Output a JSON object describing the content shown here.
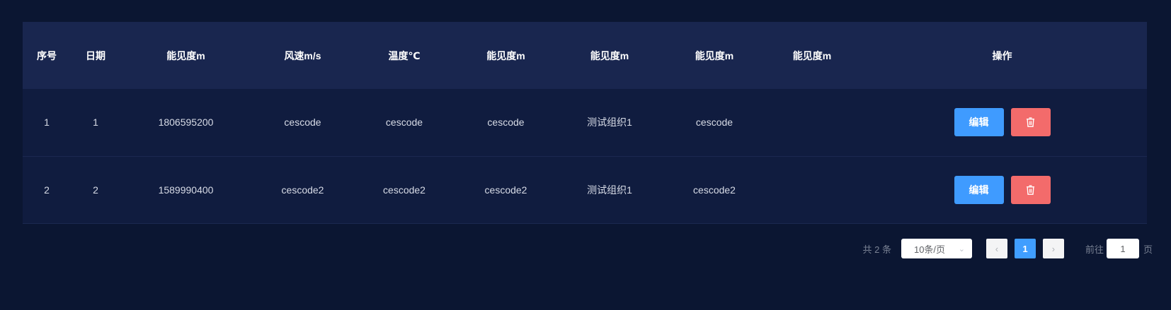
{
  "table": {
    "columns": [
      "序号",
      "日期",
      "能见度m",
      "风速m/s",
      "温度℃",
      "能见度m",
      "能见度m",
      "能见度m",
      "能见度m",
      "操作"
    ],
    "rows": [
      {
        "cells": [
          "1",
          "1",
          "1806595200",
          "cescode",
          "cescode",
          "cescode",
          "测试组织1",
          "cescode",
          ""
        ]
      },
      {
        "cells": [
          "2",
          "2",
          "1589990400",
          "cescode2",
          "cescode2",
          "cescode2",
          "测试组织1",
          "cescode2",
          ""
        ]
      }
    ],
    "edit_label": "编辑",
    "delete_icon": "trash-icon"
  },
  "pagination": {
    "total_text": "共 2 条",
    "page_size": "10条/页",
    "current_page": "1",
    "goto_prefix": "前往",
    "goto_value": "1",
    "goto_suffix": "页"
  },
  "colors": {
    "background": "#0b1632",
    "header_bg": "#19264f",
    "row_bg": "#101c3f",
    "edit_button": "#3f9bff",
    "delete_button": "#f36b6b",
    "active_page": "#409eff"
  }
}
